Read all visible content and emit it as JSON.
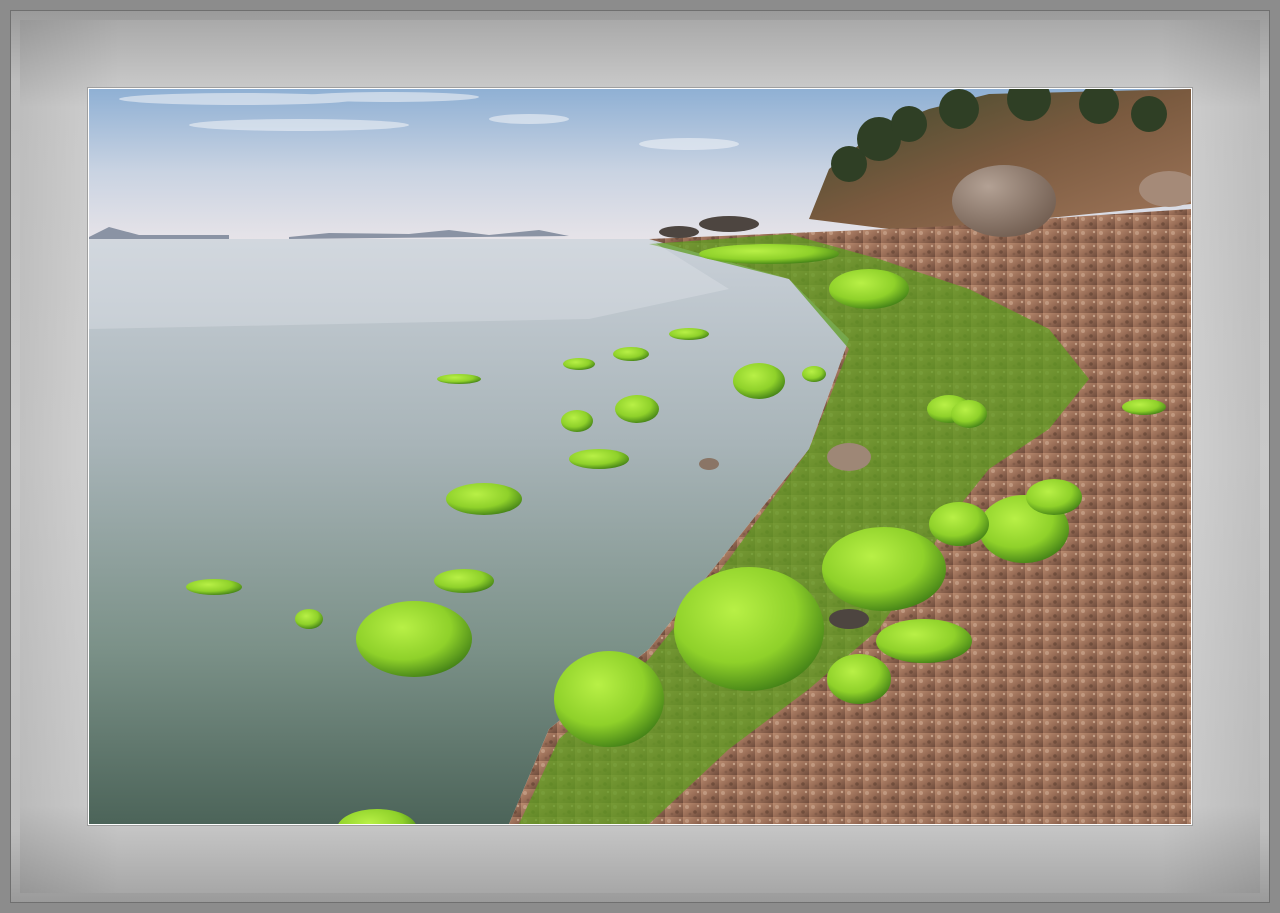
{
  "image": {
    "subject": "seascape",
    "colors": {
      "sky_top": "#8fb0d4",
      "sky_horizon": "#e6e3e8",
      "sea_far": "#c7cfd6",
      "sea_near": "#5f7a6e",
      "algae": "#8fd12a",
      "algae_dark": "#3f7d16",
      "beach": "#9a6e57",
      "hill": "#6b5440",
      "boulder": "#8a7566"
    }
  }
}
